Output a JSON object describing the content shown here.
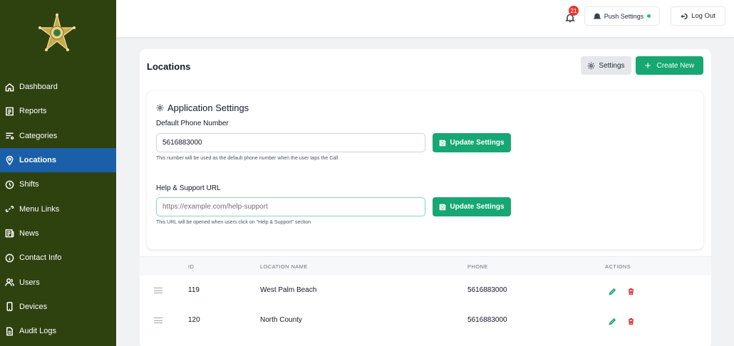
{
  "sidebar": {
    "logo_icon": "sheriff-star-badge",
    "items": [
      {
        "label": "Dashboard",
        "icon": "home-icon",
        "active": false
      },
      {
        "label": "Reports",
        "icon": "report-icon",
        "active": false
      },
      {
        "label": "Categories",
        "icon": "list-filter-icon",
        "active": false
      },
      {
        "label": "Locations",
        "icon": "map-pin-icon",
        "active": true
      },
      {
        "label": "Shifts",
        "icon": "clock-icon",
        "active": false
      },
      {
        "label": "Menu Links",
        "icon": "link-icon",
        "active": false
      },
      {
        "label": "News",
        "icon": "newspaper-icon",
        "active": false
      },
      {
        "label": "Contact Info",
        "icon": "info-icon",
        "active": false
      },
      {
        "label": "Users",
        "icon": "users-icon",
        "active": false
      },
      {
        "label": "Devices",
        "icon": "device-icon",
        "active": false
      },
      {
        "label": "Audit Logs",
        "icon": "document-icon",
        "active": false
      }
    ]
  },
  "topbar": {
    "notification_count": "21",
    "push_settings_label": "Push Settings",
    "logout_label": "Log Out"
  },
  "main": {
    "title": "Locations",
    "settings_label": "Settings",
    "create_label": "Create New",
    "app_settings": {
      "title": "Application Settings",
      "phone": {
        "label": "Default Phone Number",
        "value": "5616883000",
        "button": "Update Settings",
        "hint": "This number will be used as the default phone number when the user taps the Call"
      },
      "help": {
        "label": "Help & Support URL",
        "placeholder": "https://example.com/help-support",
        "button": "Update Settings",
        "hint": "This URL will be opened when users click on \"Help & Support\" section"
      }
    },
    "table": {
      "headers": {
        "id": "ID",
        "name": "LOCATION NAME",
        "phone": "PHONE",
        "actions": "ACTIONS"
      },
      "rows": [
        {
          "id": "119",
          "name": "West Palm Beach",
          "phone": "5616883000"
        },
        {
          "id": "120",
          "name": "North County",
          "phone": "5616883000"
        }
      ]
    }
  },
  "colors": {
    "sidebar_bg": "#2e420f",
    "active_bg": "#1a5fa8",
    "primary": "#16a774",
    "danger": "#e53935"
  }
}
